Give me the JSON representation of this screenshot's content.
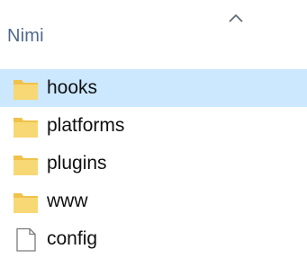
{
  "header": {
    "column_label": "Nimi",
    "sort_icon": "chevron-up-icon"
  },
  "items": [
    {
      "label": "hooks",
      "type": "folder",
      "icon": "folder-icon",
      "selected": true
    },
    {
      "label": "platforms",
      "type": "folder",
      "icon": "folder-icon",
      "selected": false
    },
    {
      "label": "plugins",
      "type": "folder",
      "icon": "folder-icon",
      "selected": false
    },
    {
      "label": "www",
      "type": "folder",
      "icon": "folder-icon",
      "selected": false
    },
    {
      "label": "config",
      "type": "file",
      "icon": "file-icon",
      "selected": false
    }
  ],
  "colors": {
    "selection": "#cce8ff",
    "folder": "#f8d775",
    "header_text": "#4f6a8b"
  }
}
